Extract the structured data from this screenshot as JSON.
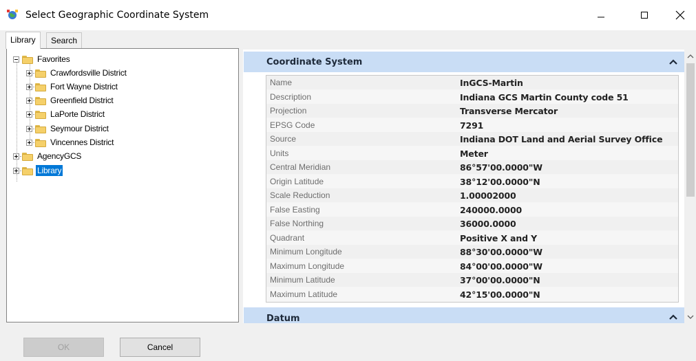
{
  "window": {
    "title": "Select Geographic Coordinate System"
  },
  "tabs": [
    {
      "label": "Library",
      "active": true
    },
    {
      "label": "Search",
      "active": false
    }
  ],
  "tree": {
    "favorites": "Favorites",
    "favorite_items": [
      "Crawfordsville District",
      "Fort Wayne District",
      "Greenfield District",
      "LaPorte District",
      "Seymour District",
      "Vincennes District"
    ],
    "agency": "AgencyGCS",
    "library": "Library"
  },
  "coordinate_system": {
    "header": "Coordinate System",
    "properties": [
      {
        "name": "Name",
        "value": "InGCS-Martin"
      },
      {
        "name": "Description",
        "value": "Indiana GCS Martin County code 51"
      },
      {
        "name": "Projection",
        "value": "Transverse Mercator"
      },
      {
        "name": "EPSG Code",
        "value": "7291"
      },
      {
        "name": "Source",
        "value": "Indiana DOT Land and Aerial Survey Office"
      },
      {
        "name": "Units",
        "value": "Meter"
      },
      {
        "name": "Central Meridian",
        "value": "86°57'00.0000\"W"
      },
      {
        "name": "Origin Latitude",
        "value": "38°12'00.0000\"N"
      },
      {
        "name": "Scale Reduction",
        "value": "1.00002000"
      },
      {
        "name": "False Easting",
        "value": "240000.0000"
      },
      {
        "name": "False Northing",
        "value": "36000.0000"
      },
      {
        "name": "Quadrant",
        "value": "Positive X and Y"
      },
      {
        "name": "Minimum Longitude",
        "value": "88°30'00.0000\"W"
      },
      {
        "name": "Maximum Longitude",
        "value": "84°00'00.0000\"W"
      },
      {
        "name": "Minimum Latitude",
        "value": "37°00'00.0000\"N"
      },
      {
        "name": "Maximum Latitude",
        "value": "42°15'00.0000\"N"
      }
    ]
  },
  "datum": {
    "header": "Datum"
  },
  "buttons": {
    "ok": "OK",
    "cancel": "Cancel"
  },
  "colors": {
    "selection": "#0078d7",
    "section_header": "#c9ddf5"
  }
}
